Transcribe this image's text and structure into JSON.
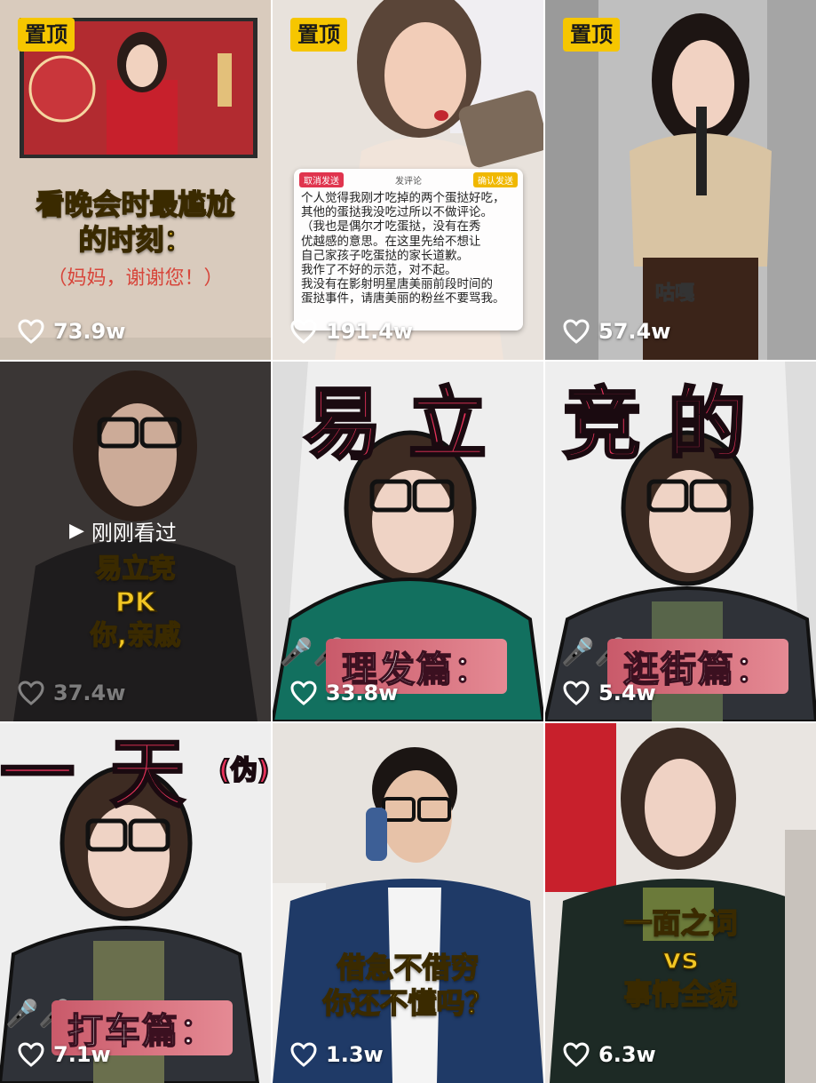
{
  "pinned_label": "置顶",
  "videos": [
    {
      "likes": "73.9w",
      "pinned": true,
      "caption_lines": [
        "看晚会时最尴尬",
        "的时刻："
      ],
      "sub_caption": "（妈妈，谢谢您！）"
    },
    {
      "likes": "191.4w",
      "pinned": true,
      "comment_card": {
        "cancel": "取消发送",
        "title": "发评论",
        "post": "确认发送",
        "text": "个人觉得我刚才吃掉的两个蛋挞好吃，\n其他的蛋挞我没吃过所以不做评论。\n（我也是偶尔才吃蛋挞，没有在秀\n优越感的意思。在这里先给不想让\n自己家孩子吃蛋挞的家长道歉。\n我作了不好的示范，对不起。\n我没有在影射明星唐美丽前段时间的\n蛋挞事件，请唐美丽的粉丝不要骂我。"
      }
    },
    {
      "likes": "57.4w",
      "pinned": true,
      "tag": "咕嘎"
    },
    {
      "likes": "37.4w",
      "pinned": false,
      "recently_watched": "刚刚看过",
      "caption_lines": [
        "易立竞",
        "PK",
        "你,亲戚"
      ]
    },
    {
      "likes": "33.8w",
      "pinned": false,
      "big_title": "易立",
      "bar": "理发篇："
    },
    {
      "likes": "5.4w",
      "pinned": false,
      "big_title": "竞的",
      "bar": "逛街篇："
    },
    {
      "likes": "7.1w",
      "pinned": false,
      "big_title": "一天",
      "big_small": "(伪)",
      "bar": "打车篇："
    },
    {
      "likes": "1.3w",
      "pinned": false,
      "caption_lines": [
        "借急不借穷",
        "你还不懂吗？"
      ]
    },
    {
      "likes": "6.3w",
      "pinned": false,
      "caption_lines": [
        "一面之词",
        "vs",
        "事情全貌"
      ]
    }
  ],
  "colors": {
    "pin_bg": "#f6c600",
    "accent_red": "#e7325a"
  }
}
